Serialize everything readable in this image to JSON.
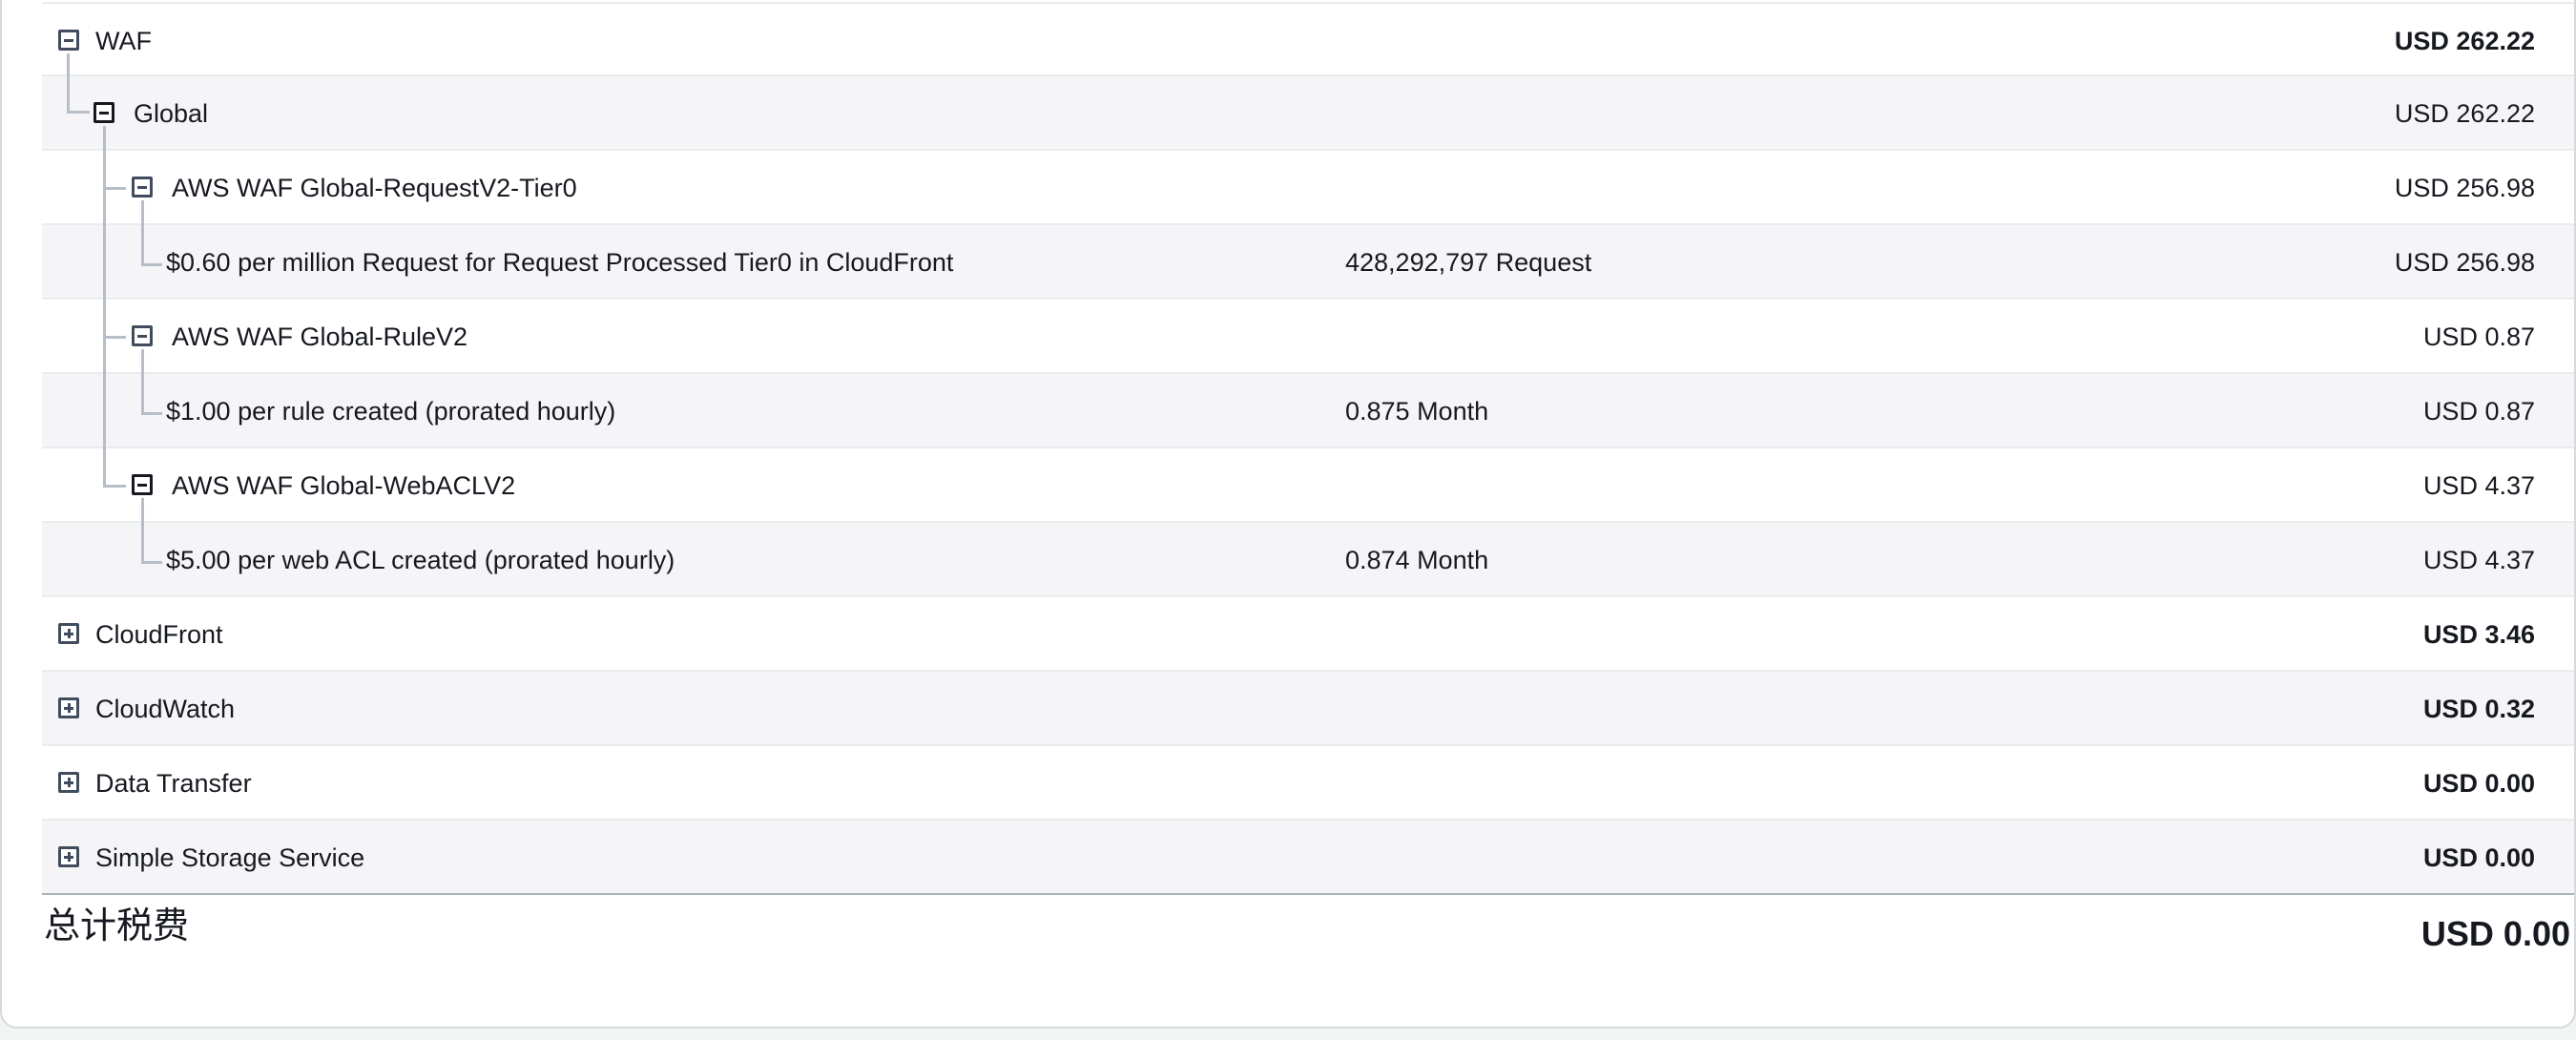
{
  "rows": [
    {
      "label": "WAF",
      "qty": "",
      "amount": "USD 262.22",
      "toggle": "collapse"
    },
    {
      "label": "Global",
      "qty": "",
      "amount": "USD 262.22",
      "toggle": "collapse"
    },
    {
      "label": "AWS WAF Global-RequestV2-Tier0",
      "qty": "",
      "amount": "USD 256.98",
      "toggle": "collapse"
    },
    {
      "label": "$0.60 per million Request for Request Processed Tier0 in CloudFront",
      "qty": "428,292,797 Request",
      "amount": "USD 256.98"
    },
    {
      "label": "AWS WAF Global-RuleV2",
      "qty": "",
      "amount": "USD 0.87",
      "toggle": "collapse"
    },
    {
      "label": "$1.00 per rule created (prorated hourly)",
      "qty": "0.875 Month",
      "amount": "USD 0.87"
    },
    {
      "label": "AWS WAF Global-WebACLV2",
      "qty": "",
      "amount": "USD 4.37",
      "toggle": "collapse"
    },
    {
      "label": "$5.00 per web ACL created (prorated hourly)",
      "qty": "0.874 Month",
      "amount": "USD 4.37"
    },
    {
      "label": "CloudFront",
      "qty": "",
      "amount": "USD 3.46",
      "toggle": "expand"
    },
    {
      "label": "CloudWatch",
      "qty": "",
      "amount": "USD 0.32",
      "toggle": "expand"
    },
    {
      "label": "Data Transfer",
      "qty": "",
      "amount": "USD 0.00",
      "toggle": "expand"
    },
    {
      "label": "Simple Storage Service",
      "qty": "",
      "amount": "USD 0.00",
      "toggle": "expand"
    }
  ],
  "footer": {
    "label": "总计税费",
    "amount": "USD 0.00"
  },
  "colors": {
    "row_alt": "#f5f5f7",
    "border": "#e9ebed",
    "tree_line": "#b6bec9",
    "icon": "#414d5c",
    "text": "#16191f"
  }
}
